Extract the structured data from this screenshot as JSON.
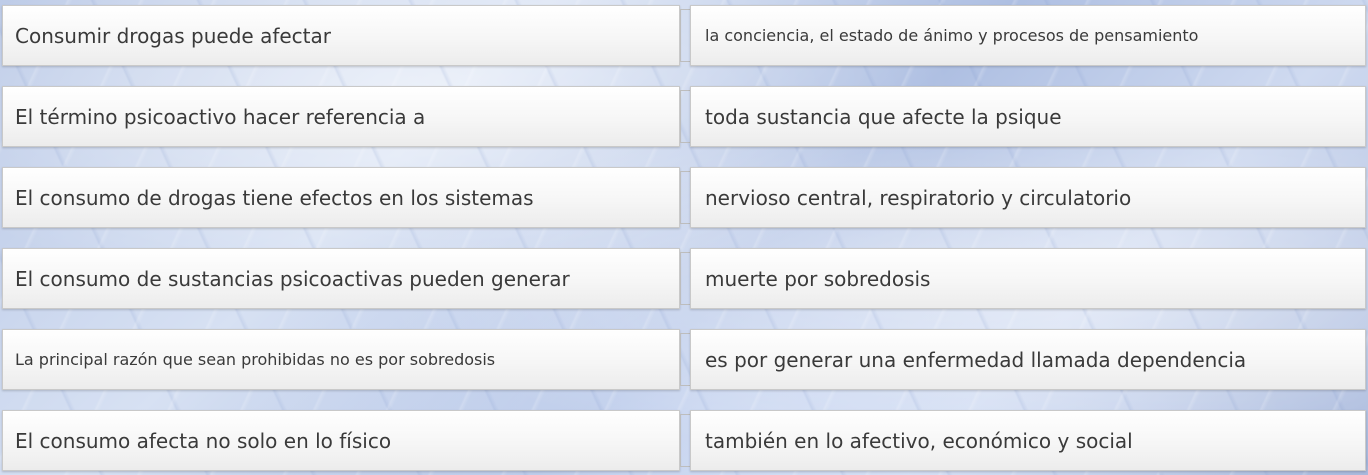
{
  "rows": [
    {
      "left": "Consumir drogas puede afectar",
      "right": "la conciencia, el estado de ánimo y procesos de pensamiento"
    },
    {
      "left": "El término psicoactivo hacer referencia a",
      "right": "toda sustancia que afecte la psique"
    },
    {
      "left": "El consumo de drogas tiene efectos en los sistemas",
      "right": "nervioso central, respiratorio y circulatorio"
    },
    {
      "left": "El consumo de sustancias psicoactivas pueden generar",
      "right": "muerte por sobredosis"
    },
    {
      "left": "La principal razón que sean prohibidas no es por sobredosis",
      "right": "es por generar una enfermedad llamada dependencia"
    },
    {
      "left": "El consumo afecta no solo en lo físico",
      "right": "también en lo afectivo, económico y social"
    }
  ]
}
